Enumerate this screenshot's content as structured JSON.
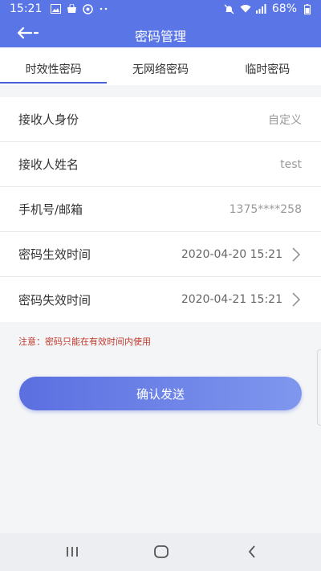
{
  "status_bar": {
    "time": "15:21",
    "battery": "68%",
    "left_icons": [
      "image-icon",
      "bag-icon",
      "app-icon",
      "more-dots-icon"
    ],
    "right_icons": [
      "mute-icon",
      "wifi-icon",
      "signal-icon",
      "battery-icon"
    ]
  },
  "header": {
    "title": "密码管理",
    "back_icon": "back-arrow-icon"
  },
  "tabs": [
    {
      "label": "时效性密码",
      "active": true
    },
    {
      "label": "无网络密码",
      "active": false
    },
    {
      "label": "临时密码",
      "active": false
    }
  ],
  "form": {
    "rows": [
      {
        "label": "接收人身份",
        "value": "自定义",
        "chevron": false
      },
      {
        "label": "接收人姓名",
        "value": "test",
        "chevron": false
      },
      {
        "label": "手机号/邮箱",
        "value": "1375****258",
        "chevron": false
      },
      {
        "label": "密码生效时间",
        "value": "2020-04-20 15:21",
        "chevron": true
      },
      {
        "label": "密码失效时间",
        "value": "2020-04-21 15:21",
        "chevron": true
      }
    ]
  },
  "notice": "注意：密码只能在有效时间内使用",
  "confirm_button": "确认发送",
  "colors": {
    "header": "#5a76e6",
    "tab_indicator": "#4a62d8",
    "notice": "#c0392b",
    "button_gradient_start": "#5b6fe0",
    "button_gradient_end": "#7f97ee"
  },
  "system_nav": {
    "recents_icon": "recents-icon",
    "home_icon": "home-icon",
    "back_icon": "back-icon"
  }
}
